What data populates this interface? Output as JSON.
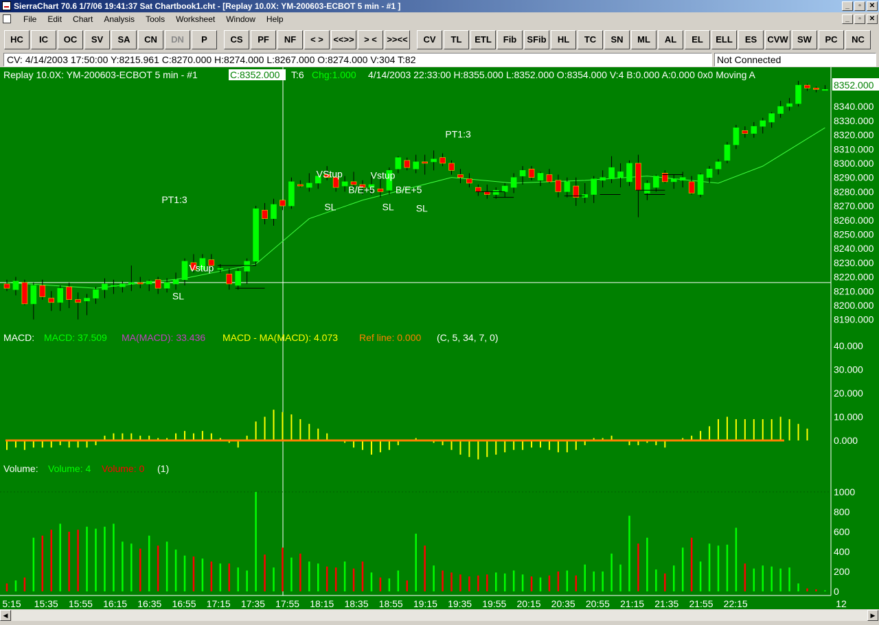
{
  "window": {
    "title": "SierraChart 70.6  1/7/06  19:41:37  Sat   Chartbook1.cht - [Replay 10.0X: YM-200603-ECBOT  5 min - #1  ]",
    "controls": [
      "_",
      "▫",
      "✕"
    ]
  },
  "menu": [
    "File",
    "Edit",
    "Chart",
    "Analysis",
    "Tools",
    "Worksheet",
    "Window",
    "Help"
  ],
  "toolbar": [
    {
      "label": "HC",
      "enabled": true
    },
    {
      "label": "IC",
      "enabled": true
    },
    {
      "label": "OC",
      "enabled": true
    },
    {
      "label": "SV",
      "enabled": true
    },
    {
      "label": "SA",
      "enabled": true
    },
    {
      "label": "CN",
      "enabled": true
    },
    {
      "label": "DN",
      "enabled": false
    },
    {
      "label": "P",
      "enabled": true
    },
    {
      "label": "CS",
      "enabled": true
    },
    {
      "label": "PF",
      "enabled": true
    },
    {
      "label": "NF",
      "enabled": true
    },
    {
      "label": "< >",
      "enabled": true
    },
    {
      "label": "<<>>",
      "enabled": true
    },
    {
      "label": "> <",
      "enabled": true
    },
    {
      "label": ">><<",
      "enabled": true
    },
    {
      "label": "CV",
      "enabled": true
    },
    {
      "label": "TL",
      "enabled": true
    },
    {
      "label": "ETL",
      "enabled": true
    },
    {
      "label": "Fib",
      "enabled": true
    },
    {
      "label": "SFib",
      "enabled": true
    },
    {
      "label": "HL",
      "enabled": true
    },
    {
      "label": "TC",
      "enabled": true
    },
    {
      "label": "SN",
      "enabled": true
    },
    {
      "label": "ML",
      "enabled": true
    },
    {
      "label": "AL",
      "enabled": true
    },
    {
      "label": "EL",
      "enabled": true
    },
    {
      "label": "ELL",
      "enabled": true
    },
    {
      "label": "ES",
      "enabled": true
    },
    {
      "label": "CVW",
      "enabled": true
    },
    {
      "label": "SW",
      "enabled": true
    },
    {
      "label": "PC",
      "enabled": true
    },
    {
      "label": "NC",
      "enabled": true
    }
  ],
  "status": {
    "cursor_values": "CV:  4/14/2003  17:50:00  Y:8215.961  C:8270.000  H:8274.000  L:8267.000  O:8274.000  V:304  T:82",
    "connection": "Not Connected"
  },
  "chart": {
    "header_title": "Replay 10.0X: YM-200603-ECBOT  5 min - #1",
    "header_close": "C:8352.000",
    "header_ticks": "T:6",
    "header_change": "Chg:1.000",
    "header_rest": "4/14/2003  22:33:00  H:8355.000  L:8352.000  O:8354.000  V:4  B:0.000  A:0.000  0x0  Moving A",
    "last_price_label": "8352.000",
    "price_axis": [
      "8340.000",
      "8330.000",
      "8320.000",
      "8310.000",
      "8300.000",
      "8290.000",
      "8280.000",
      "8270.000",
      "8260.000",
      "8250.000",
      "8240.000",
      "8230.000",
      "8220.000",
      "8210.000",
      "8200.000",
      "8190.000"
    ],
    "macd_label": "MACD:",
    "macd_value": "MACD: 37.509",
    "ma_macd_value": "MA(MACD): 33.436",
    "macd_diff_value": "MACD - MA(MACD): 4.073",
    "ref_line_value": "Ref line: 0.000",
    "macd_params": "(C, 5, 34, 7, 0)",
    "macd_axis": [
      "40.000",
      "30.000",
      "20.000",
      "10.000",
      "0.000"
    ],
    "volume_label": "Volume:",
    "volume_value": "Volume: 4",
    "volume_down_value": "Volume: 0",
    "volume_params": "(1)",
    "volume_axis": [
      "1000",
      "800",
      "600",
      "400",
      "200",
      "0"
    ],
    "time_axis": [
      "5:15",
      "15:35",
      "15:55",
      "16:15",
      "16:35",
      "16:55",
      "17:15",
      "17:35",
      "17:55",
      "18:15",
      "18:35",
      "18:55",
      "19:15",
      "19:35",
      "19:55",
      "20:15",
      "20:35",
      "20:55",
      "21:15",
      "21:35",
      "21:55",
      "22:15",
      "12"
    ],
    "annotations": [
      {
        "text": "PT1:3",
        "time_index": 17.4,
        "price": 8272
      },
      {
        "text": "Vstup",
        "time_index": 20.5,
        "price": 8224
      },
      {
        "text": "SL",
        "time_index": 18.6,
        "price": 8204
      },
      {
        "text": "VStup",
        "time_index": 34.8,
        "price": 8290
      },
      {
        "text": "B/E+5",
        "time_index": 38.4,
        "price": 8279
      },
      {
        "text": "SL",
        "time_index": 35.7,
        "price": 8267
      },
      {
        "text": "Vstup",
        "time_index": 40.9,
        "price": 8289
      },
      {
        "text": "SL",
        "time_index": 42.2,
        "price": 8267
      },
      {
        "text": "B/E+5",
        "time_index": 43.7,
        "price": 8279
      },
      {
        "text": "SL",
        "time_index": 46.0,
        "price": 8266
      },
      {
        "text": "PT1:3",
        "time_index": 49.3,
        "price": 8318
      }
    ],
    "colors": {
      "background": "#008000",
      "up": "#00ff00",
      "down": "#ff0000",
      "macd": "#ffff00",
      "ref": "#ff8000",
      "ma": "#40ff40",
      "text": "#ffffff"
    }
  },
  "chart_data": {
    "type": "candlestick",
    "interval": "5 min",
    "start_time": "15:15",
    "price_ylim": [
      8185,
      8357
    ],
    "candles": [
      [
        8215,
        8218,
        8210,
        8212
      ],
      [
        8211,
        8220,
        8207,
        8217
      ],
      [
        8216,
        8218,
        8200,
        8201
      ],
      [
        8201,
        8216,
        8190,
        8214
      ],
      [
        8214,
        8218,
        8204,
        8206
      ],
      [
        8205,
        8210,
        8196,
        8202
      ],
      [
        8202,
        8214,
        8196,
        8212
      ],
      [
        8213,
        8216,
        8198,
        8204
      ],
      [
        8204,
        8209,
        8190,
        8202
      ],
      [
        8203,
        8208,
        8193,
        8205
      ],
      [
        8205,
        8213,
        8201,
        8211
      ],
      [
        8211,
        8219,
        8205,
        8215
      ],
      [
        8214,
        8218,
        8208,
        8214
      ],
      [
        8213,
        8217,
        8209,
        8215
      ],
      [
        8215,
        8228,
        8210,
        8216
      ],
      [
        8216,
        8220,
        8212,
        8215
      ],
      [
        8215,
        8218,
        8210,
        8217
      ],
      [
        8218,
        8220,
        8208,
        8212
      ],
      [
        8212,
        8219,
        8209,
        8216
      ],
      [
        8215,
        8223,
        8211,
        8218
      ],
      [
        8218,
        8233,
        8214,
        8231
      ],
      [
        8230,
        8236,
        8223,
        8225
      ],
      [
        8225,
        8236,
        8224,
        8233
      ],
      [
        8232,
        8236,
        8226,
        8228
      ],
      [
        8226,
        8229,
        8223,
        8226
      ],
      [
        8222,
        8226,
        8211,
        8215
      ],
      [
        8214,
        8226,
        8211,
        8224
      ],
      [
        8224,
        8233,
        8215,
        8231
      ],
      [
        8231,
        8270,
        8228,
        8268
      ],
      [
        8267,
        8272,
        8257,
        8261
      ],
      [
        8261,
        8275,
        8256,
        8271
      ],
      [
        8274,
        8274,
        8267,
        8270
      ],
      [
        8270,
        8290,
        8268,
        8287
      ],
      [
        8285,
        8288,
        8283,
        8284
      ],
      [
        8283,
        8293,
        8280,
        8286
      ],
      [
        8286,
        8293,
        8282,
        8291
      ],
      [
        8292,
        8298,
        8288,
        8290
      ],
      [
        8290,
        8291,
        8280,
        8283
      ],
      [
        8284,
        8291,
        8280,
        8287
      ],
      [
        8287,
        8294,
        8282,
        8285
      ],
      [
        8285,
        8288,
        8278,
        8283
      ],
      [
        8283,
        8291,
        8278,
        8285
      ],
      [
        8282,
        8290,
        8276,
        8280
      ],
      [
        8281,
        8297,
        8278,
        8295
      ],
      [
        8296,
        8305,
        8293,
        8304
      ],
      [
        8302,
        8304,
        8295,
        8297
      ],
      [
        8296,
        8306,
        8293,
        8301
      ],
      [
        8301,
        8306,
        8292,
        8300
      ],
      [
        8301,
        8309,
        8295,
        8303
      ],
      [
        8304,
        8307,
        8298,
        8300
      ],
      [
        8300,
        8302,
        8292,
        8295
      ],
      [
        8292,
        8296,
        8286,
        8290
      ],
      [
        8289,
        8293,
        8283,
        8286
      ],
      [
        8283,
        8285,
        8277,
        8280
      ],
      [
        8280,
        8285,
        8275,
        8278
      ],
      [
        8278,
        8283,
        8275,
        8281
      ],
      [
        8280,
        8286,
        8276,
        8284
      ],
      [
        8283,
        8293,
        8279,
        8290
      ],
      [
        8291,
        8298,
        8285,
        8295
      ],
      [
        8296,
        8298,
        8288,
        8290
      ],
      [
        8288,
        8294,
        8284,
        8293
      ],
      [
        8292,
        8296,
        8286,
        8287
      ],
      [
        8288,
        8292,
        8276,
        8280
      ],
      [
        8280,
        8290,
        8276,
        8287
      ],
      [
        8284,
        8290,
        8270,
        8276
      ],
      [
        8276,
        8286,
        8272,
        8278
      ],
      [
        8278,
        8291,
        8272,
        8289
      ],
      [
        8288,
        8295,
        8283,
        8290
      ],
      [
        8289,
        8305,
        8286,
        8297
      ],
      [
        8290,
        8300,
        8283,
        8294
      ],
      [
        8287,
        8302,
        8284,
        8300
      ],
      [
        8300,
        8306,
        8262,
        8281
      ],
      [
        8279,
        8288,
        8274,
        8286
      ],
      [
        8283,
        8292,
        8280,
        8291
      ],
      [
        8293,
        8295,
        8286,
        8287
      ],
      [
        8287,
        8292,
        8282,
        8289
      ],
      [
        8288,
        8294,
        8283,
        8290
      ],
      [
        8287,
        8291,
        8278,
        8279
      ],
      [
        8278,
        8293,
        8276,
        8292
      ],
      [
        8290,
        8298,
        8286,
        8296
      ],
      [
        8296,
        8303,
        8292,
        8301
      ],
      [
        8302,
        8315,
        8300,
        8313
      ],
      [
        8313,
        8327,
        8310,
        8325
      ],
      [
        8323,
        8326,
        8318,
        8321
      ],
      [
        8321,
        8329,
        8318,
        8326
      ],
      [
        8326,
        8332,
        8321,
        8330
      ],
      [
        8329,
        8336,
        8325,
        8335
      ],
      [
        8335,
        8344,
        8332,
        8340
      ],
      [
        8340,
        8346,
        8337,
        8342
      ],
      [
        8342,
        8358,
        8340,
        8355
      ],
      [
        8355,
        8356,
        8351,
        8353
      ],
      [
        8353,
        8354,
        8350,
        8352
      ],
      [
        8352,
        8355,
        8351,
        8352
      ]
    ],
    "moving_average": [
      [
        0,
        8216
      ],
      [
        10,
        8212
      ],
      [
        20,
        8219
      ],
      [
        28,
        8229
      ],
      [
        34,
        8261
      ],
      [
        40,
        8274
      ],
      [
        45,
        8282
      ],
      [
        50,
        8290
      ],
      [
        57,
        8286
      ],
      [
        65,
        8288
      ],
      [
        72,
        8291
      ],
      [
        80,
        8286
      ],
      [
        85,
        8298
      ],
      [
        92,
        8325
      ]
    ],
    "macd_hist": [
      -4,
      -3,
      -4,
      -3,
      -3,
      -3,
      -2,
      -3,
      -3,
      -3,
      -2,
      2,
      3,
      3,
      3,
      2,
      2,
      1,
      1,
      3,
      4,
      3,
      4,
      3,
      1,
      -1,
      -3,
      2,
      8,
      10,
      13,
      12,
      11,
      9,
      7,
      5,
      3,
      0,
      -1,
      -3,
      -4,
      -6,
      -5,
      -4,
      -2,
      0,
      1,
      0,
      -1,
      -2,
      -4,
      -6,
      -7,
      -8,
      -7,
      -6,
      -5,
      -4,
      -4,
      -3,
      -3,
      -4,
      -5,
      -5,
      -4,
      -2,
      1,
      1,
      2,
      0,
      -2,
      -2,
      -1,
      -2,
      -3,
      0,
      1,
      2,
      4,
      6,
      9,
      10,
      9,
      9,
      9,
      9,
      9,
      10,
      9,
      7,
      5
    ],
    "volume": [
      80,
      110,
      140,
      540,
      560,
      620,
      680,
      600,
      620,
      650,
      630,
      650,
      680,
      500,
      480,
      430,
      560,
      460,
      500,
      420,
      360,
      350,
      330,
      300,
      280,
      280,
      240,
      210,
      1000,
      370,
      240,
      440,
      340,
      380,
      300,
      280,
      250,
      240,
      300,
      230,
      300,
      190,
      140,
      130,
      210,
      110,
      580,
      460,
      260,
      210,
      190,
      170,
      150,
      160,
      170,
      190,
      180,
      210,
      170,
      150,
      140,
      160,
      200,
      210,
      160,
      270,
      200,
      200,
      380,
      270,
      760,
      480,
      540,
      220,
      180,
      260,
      440,
      540,
      300,
      480,
      460,
      470,
      640,
      280,
      230,
      260,
      250,
      230,
      240,
      80,
      30,
      20,
      10
    ]
  }
}
